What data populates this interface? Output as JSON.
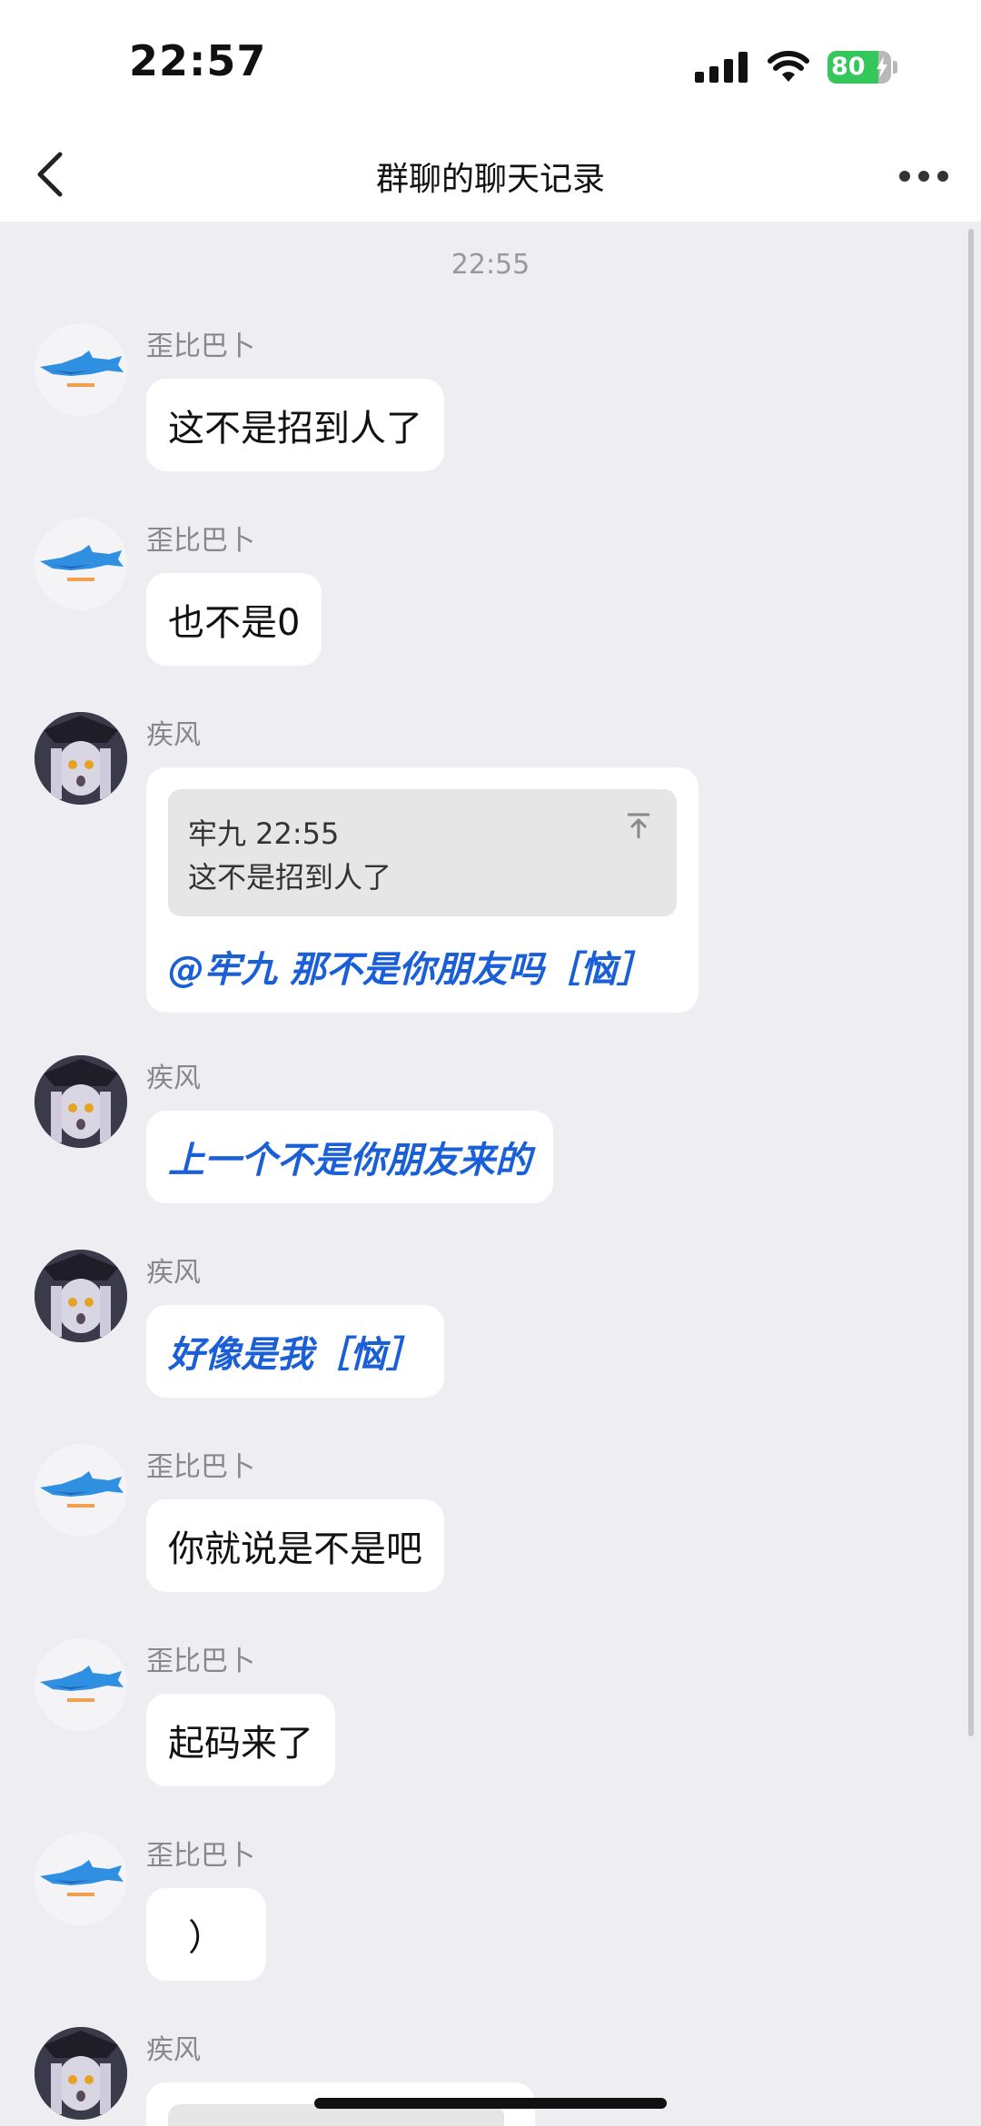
{
  "status_bar": {
    "time": "22:57",
    "battery_level": "80",
    "battery_fraction": 0.8
  },
  "nav": {
    "title": "群聊的聊天记录",
    "back_icon": "chevron-left-icon",
    "more_icon": "more-horizontal-icon"
  },
  "chat": {
    "time_divider": "22:55",
    "messages": [
      {
        "sender": "歪比巴卜",
        "text": "这不是招到人了"
      },
      {
        "sender": "歪比巴卜",
        "text": "也不是0"
      },
      {
        "sender": "疾风",
        "quote": {
          "author_time": "牢九 22:55",
          "text": "这不是招到人了"
        },
        "text": "@牢九 那不是你朋友吗［恼］"
      },
      {
        "sender": "疾风",
        "text": "上一个不是你朋友来的"
      },
      {
        "sender": "疾风",
        "text": "好像是我［恼］"
      },
      {
        "sender": "歪比巴卜",
        "text": "你就说是不是吧"
      },
      {
        "sender": "歪比巴卜",
        "text": "起码来了"
      },
      {
        "sender": "歪比巴卜",
        "text": "）"
      },
      {
        "sender": "疾风"
      }
    ]
  },
  "colors": {
    "chat_background": "#ededf2",
    "mention_text": "#1a5fd6",
    "battery_green": "#34c759"
  }
}
